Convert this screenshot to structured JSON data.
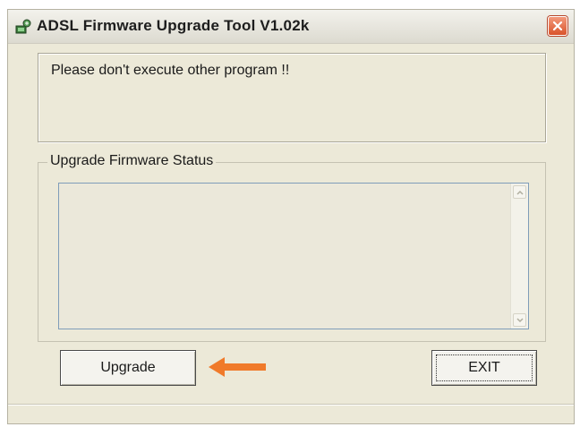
{
  "window": {
    "title": "ADSL Firmware Upgrade Tool V1.02k",
    "icon": "network-app-icon",
    "close_icon": "close-icon"
  },
  "message": {
    "text": "Please don't execute other program !!"
  },
  "status_group": {
    "label": "Upgrade Firmware Status",
    "content": ""
  },
  "buttons": {
    "upgrade_label": "Upgrade",
    "exit_label": "EXIT"
  },
  "annotation": {
    "arrow_icon": "orange-arrow-left-icon",
    "arrow_color": "#f07a2a"
  },
  "colors": {
    "window_bg": "#ece9d8",
    "close_button": "#d9532b"
  }
}
